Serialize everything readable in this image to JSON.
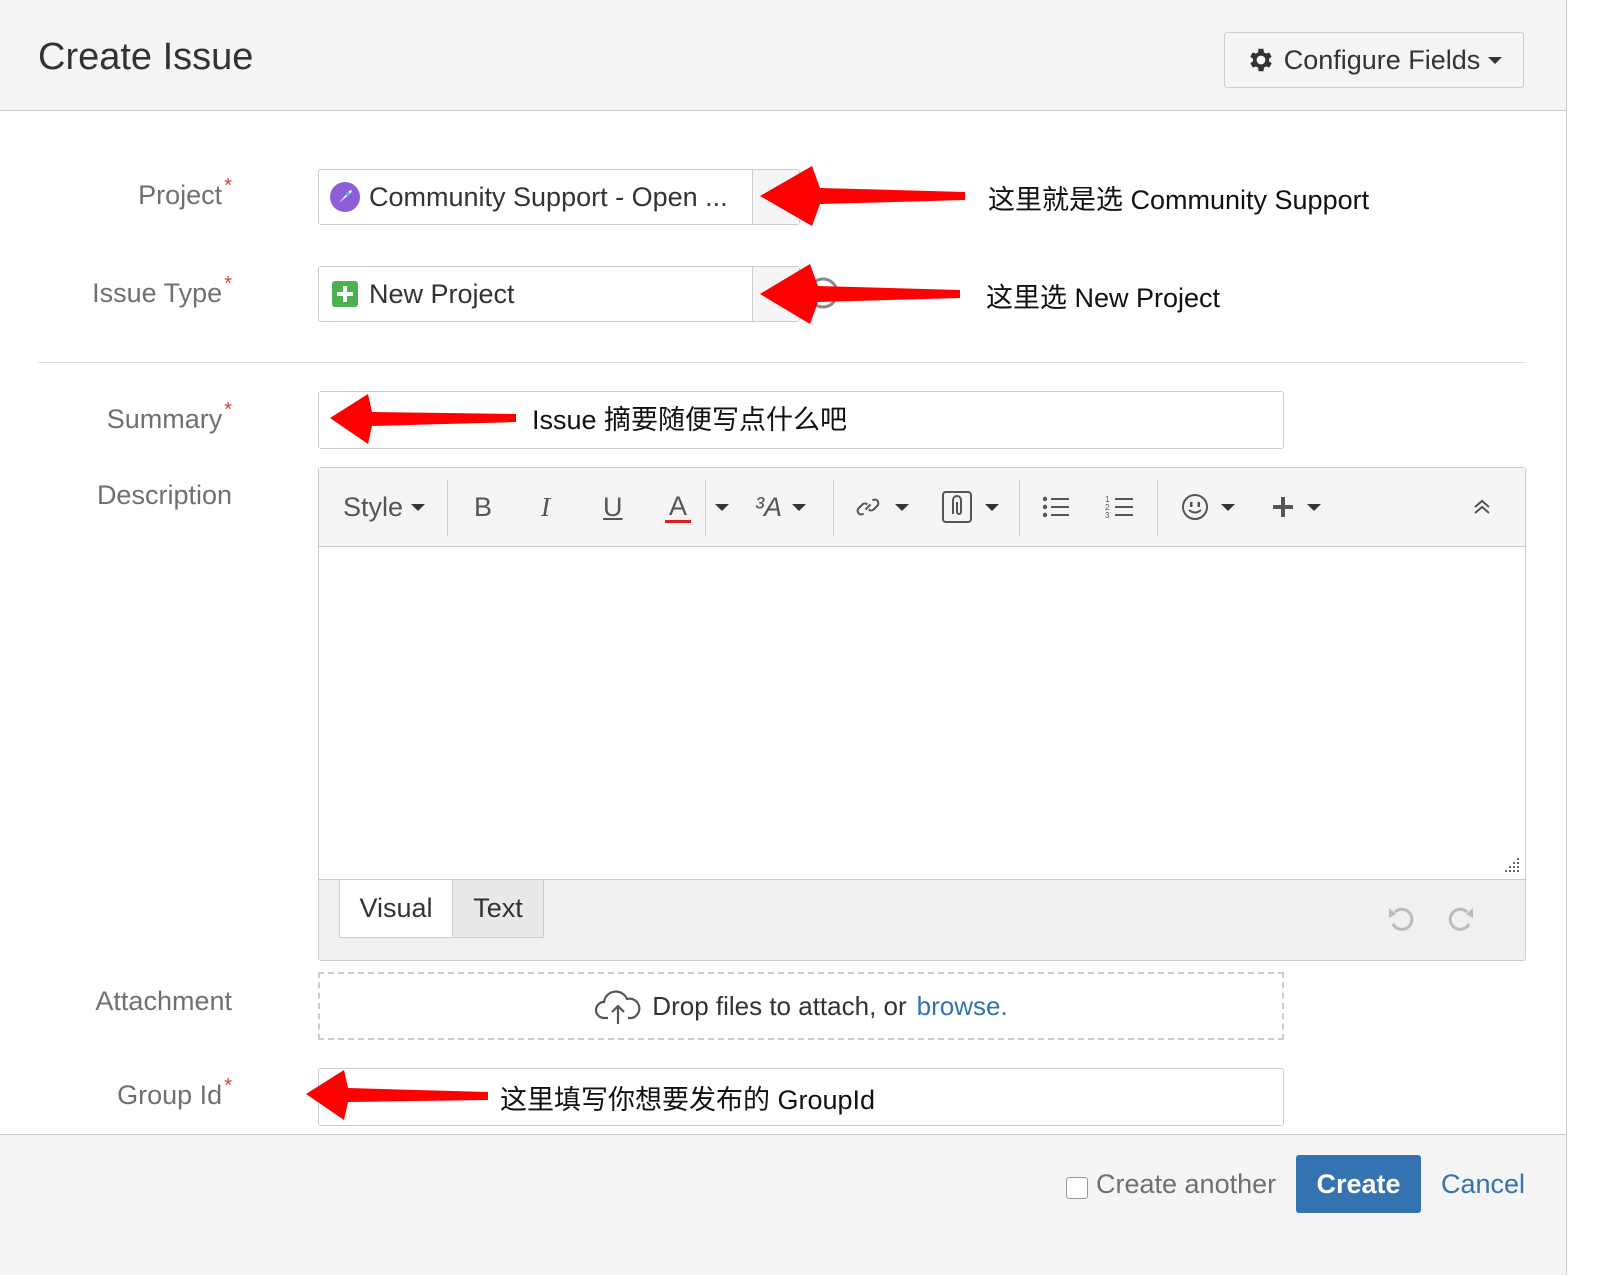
{
  "dialog": {
    "title": "Create Issue",
    "configure_fields_label": "Configure Fields"
  },
  "fields": {
    "project": {
      "label": "Project",
      "value": "Community Support - Open ..."
    },
    "issue_type": {
      "label": "Issue Type",
      "value": "New Project"
    },
    "summary": {
      "label": "Summary",
      "value": ""
    },
    "description": {
      "label": "Description"
    },
    "attachment": {
      "label": "Attachment",
      "drop_text": "Drop files to attach, or",
      "browse_link": "browse."
    },
    "group_id": {
      "label": "Group Id",
      "value": ""
    },
    "required_mark": "*"
  },
  "editor": {
    "toolbar": {
      "style_label": "Style",
      "bold": "B",
      "italic": "I",
      "underline": "U",
      "text_color": "A",
      "more_formatting": "³A"
    },
    "tabs": [
      {
        "label": "Visual"
      },
      {
        "label": "Text"
      }
    ]
  },
  "footer": {
    "create_another_label": "Create another",
    "create_label": "Create",
    "cancel_label": "Cancel"
  },
  "annotations": {
    "project_note": "这里就是选 Community Support",
    "issue_type_note": "这里选 New Project",
    "summary_note": "Issue 摘要随便写点什么吧",
    "group_id_note": "这里填写你想要发布的 GroupId"
  },
  "colors": {
    "primary": "#3572b0",
    "required": "#d04437",
    "annotation_arrow": "#ff0000",
    "issue_type_icon": "#4caf50"
  }
}
